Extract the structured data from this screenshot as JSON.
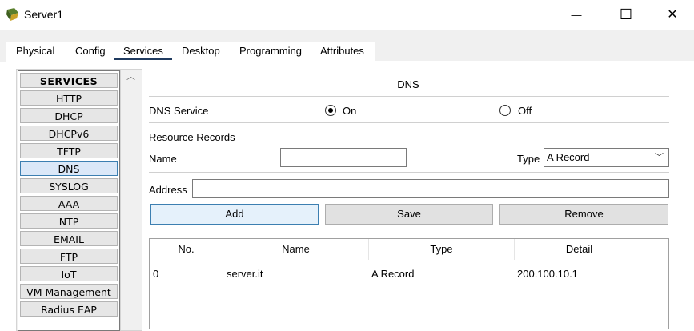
{
  "window": {
    "title": "Server1",
    "minimize_glyph": "—",
    "maximize_glyph": "☐",
    "close_glyph": "✕"
  },
  "tabs": [
    {
      "label": "Physical"
    },
    {
      "label": "Config"
    },
    {
      "label": "Services",
      "active": true
    },
    {
      "label": "Desktop"
    },
    {
      "label": "Programming"
    },
    {
      "label": "Attributes"
    }
  ],
  "services": {
    "header": "SERVICES",
    "items": [
      {
        "label": "HTTP"
      },
      {
        "label": "DHCP"
      },
      {
        "label": "DHCPv6"
      },
      {
        "label": "TFTP"
      },
      {
        "label": "DNS",
        "selected": true
      },
      {
        "label": "SYSLOG"
      },
      {
        "label": "AAA"
      },
      {
        "label": "NTP"
      },
      {
        "label": "EMAIL"
      },
      {
        "label": "FTP"
      },
      {
        "label": "IoT"
      },
      {
        "label": "VM Management"
      },
      {
        "label": "Radius EAP"
      }
    ],
    "scroll_up_glyph": "︿"
  },
  "dns": {
    "title": "DNS",
    "service_label": "DNS Service",
    "on_label": "On",
    "off_label": "Off",
    "service_state": "On",
    "resource_records_label": "Resource Records",
    "name_label": "Name",
    "name_value": "",
    "type_label": "Type",
    "type_value": "A Record",
    "address_label": "Address",
    "address_value": "",
    "add_button": "Add",
    "save_button": "Save",
    "remove_button": "Remove",
    "table": {
      "columns": [
        "No.",
        "Name",
        "Type",
        "Detail"
      ],
      "rows": [
        {
          "no": "0",
          "name": "server.it",
          "type": "A Record",
          "detail": "200.100.10.1"
        }
      ]
    }
  }
}
